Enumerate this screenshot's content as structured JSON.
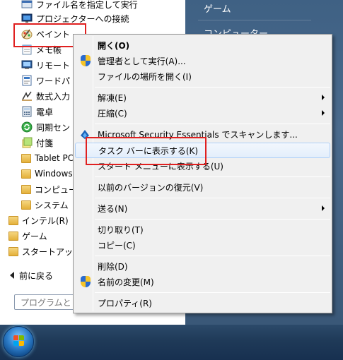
{
  "start_menu": {
    "programs": [
      {
        "label": "ファイル名を指定して実行",
        "icon": "run-icon"
      },
      {
        "label": "プロジェクターへの接続",
        "icon": "projector-icon"
      },
      {
        "label": "ペイント",
        "icon": "paint-icon"
      },
      {
        "label": "メモ帳",
        "icon": "notepad-icon"
      },
      {
        "label": "リモート",
        "icon": "remote-desktop-icon"
      },
      {
        "label": "ワードパ",
        "icon": "wordpad-icon"
      },
      {
        "label": "数式入力",
        "icon": "math-input-icon"
      },
      {
        "label": "電卓",
        "icon": "calculator-icon"
      },
      {
        "label": "同期セン",
        "icon": "sync-center-icon"
      },
      {
        "label": "付箋",
        "icon": "sticky-notes-icon"
      },
      {
        "label": "Tablet PC",
        "icon": "folder-icon"
      },
      {
        "label": "Windows",
        "icon": "folder-icon"
      },
      {
        "label": "コンピュー",
        "icon": "folder-icon"
      },
      {
        "label": "システム",
        "icon": "folder-icon"
      }
    ],
    "folders": [
      {
        "label": "インテル(R)"
      },
      {
        "label": "ゲーム"
      },
      {
        "label": "スタートアッ"
      }
    ],
    "back_label": "前に戻る",
    "search_placeholder": "プログラムと",
    "right_items": [
      {
        "label": "ゲーム"
      },
      {
        "label": "コンピューター"
      }
    ]
  },
  "context_menu": {
    "items": [
      {
        "label": "開く(O)",
        "bold": true
      },
      {
        "label": "管理者として実行(A)...",
        "icon": "uac-shield-icon"
      },
      {
        "label": "ファイルの場所を開く(I)"
      },
      {
        "label": "解凍(E)",
        "submenu": true
      },
      {
        "label": "圧縮(C)",
        "submenu": true
      },
      {
        "label": "Microsoft Security Essentials でスキャンします...",
        "icon": "mse-icon"
      },
      {
        "label": "タスク バーに表示する(K)",
        "highlighted": true
      },
      {
        "label": "スタート メニューに表示する(U)"
      },
      {
        "label": "以前のバージョンの復元(V)"
      },
      {
        "label": "送る(N)",
        "submenu": true
      },
      {
        "label": "切り取り(T)"
      },
      {
        "label": "コピー(C)"
      },
      {
        "label": "削除(D)"
      },
      {
        "label": "名前の変更(M)",
        "icon": "uac-shield-icon"
      },
      {
        "label": "プロパティ(R)"
      }
    ]
  },
  "colors": {
    "annotation_red": "#e02020",
    "menu_bg": "#f0f0f0",
    "right_pane": "#4a6a8c",
    "taskbar": "#1f3a58"
  }
}
